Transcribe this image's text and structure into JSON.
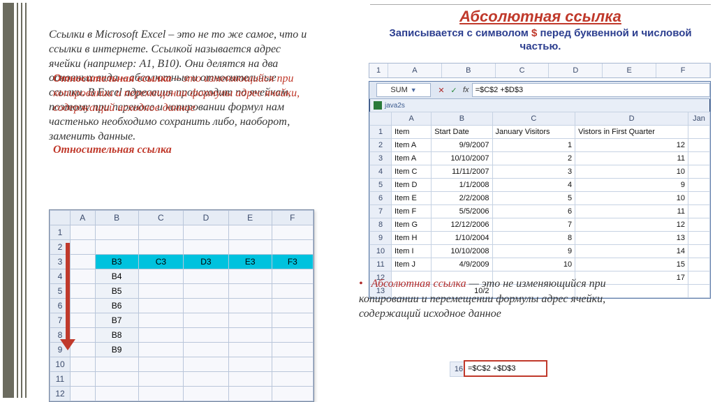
{
  "main_text": "Ссылки в Microsoft Excel – это не то же самое, что и ссылки в интернете. Ссылкой называется адрес ячейки (например: А1, В10). Они делятся на два основных вида – абсолютные и относительные ссылки. В Excel адресация происходит по ячейкам, поэтому при переносе и копировании формул нам частенько необходимо сохранить либо, наоборот, заменить данные.",
  "rel_overlay": {
    "head": "Относительная ссылка",
    "body": " – это изменяющийся при копировании и перемещении формулы адрес ячейки, содержащий исходное данное",
    "head2": "Относительная ссылка"
  },
  "abs_header": {
    "title": "Абсолютная ссылка",
    "sub_before": "Записывается с символом ",
    "sym": "$",
    "sub_after": " перед буквенной и числовой частью."
  },
  "top_strip": {
    "row": "1",
    "cols": [
      "A",
      "B",
      "C",
      "D",
      "E",
      "F"
    ]
  },
  "panel": {
    "namebox": "SUM",
    "formula": "=$C$2 +$D$3",
    "tab": "java2s",
    "cols": [
      "A",
      "B",
      "C",
      "D",
      ""
    ],
    "col_e_head": "Jan",
    "headers": [
      "Item",
      "Start Date",
      "January Visitors",
      "Vistors in First Quarter"
    ],
    "rows": [
      {
        "n": "1"
      },
      {
        "n": "2",
        "a": "Item A",
        "b": "9/9/2007",
        "c": "1",
        "d": "12"
      },
      {
        "n": "3",
        "a": "Item A",
        "b": "10/10/2007",
        "c": "2",
        "d": "11"
      },
      {
        "n": "4",
        "a": "Item C",
        "b": "11/11/2007",
        "c": "3",
        "d": "10"
      },
      {
        "n": "5",
        "a": "Item D",
        "b": "1/1/2008",
        "c": "4",
        "d": "9"
      },
      {
        "n": "6",
        "a": "Item E",
        "b": "2/2/2008",
        "c": "5",
        "d": "10"
      },
      {
        "n": "7",
        "a": "Item F",
        "b": "5/5/2006",
        "c": "6",
        "d": "11"
      },
      {
        "n": "8",
        "a": "Item G",
        "b": "12/12/2006",
        "c": "7",
        "d": "12"
      },
      {
        "n": "9",
        "a": "Item H",
        "b": "1/10/2004",
        "c": "8",
        "d": "13"
      },
      {
        "n": "10",
        "a": "Item I",
        "b": "10/10/2008",
        "c": "9",
        "d": "14"
      },
      {
        "n": "11",
        "a": "Item J",
        "b": "4/9/2009",
        "c": "10",
        "d": "15"
      },
      {
        "n": "12",
        "a": "",
        "b": "",
        "c": "",
        "d": "17"
      },
      {
        "n": "13",
        "a": "",
        "b": "10/2",
        "c": "",
        "d": ""
      }
    ],
    "row16": "16",
    "edit16": "=$C$2 +$D$3"
  },
  "abs_bullet": {
    "acc": "Абсолютная ссылка",
    "rest": " — это не изменяющийся при копировании и перемещении формулы адрес ячейки, содержащий исходное данное"
  },
  "left_grid": {
    "cols": [
      "A",
      "B",
      "C",
      "D",
      "E",
      "F"
    ],
    "rows": [
      {
        "n": "1"
      },
      {
        "n": "2"
      },
      {
        "n": "3",
        "b": "B3",
        "c": "C3",
        "d": "D3",
        "e": "E3",
        "f": "F3"
      },
      {
        "n": "4",
        "b": "B4"
      },
      {
        "n": "5",
        "b": "B5"
      },
      {
        "n": "6",
        "b": "B6"
      },
      {
        "n": "7",
        "b": "B7"
      },
      {
        "n": "8",
        "b": "B8"
      },
      {
        "n": "9",
        "b": "B9"
      },
      {
        "n": "10"
      },
      {
        "n": "11"
      },
      {
        "n": "12"
      }
    ]
  }
}
